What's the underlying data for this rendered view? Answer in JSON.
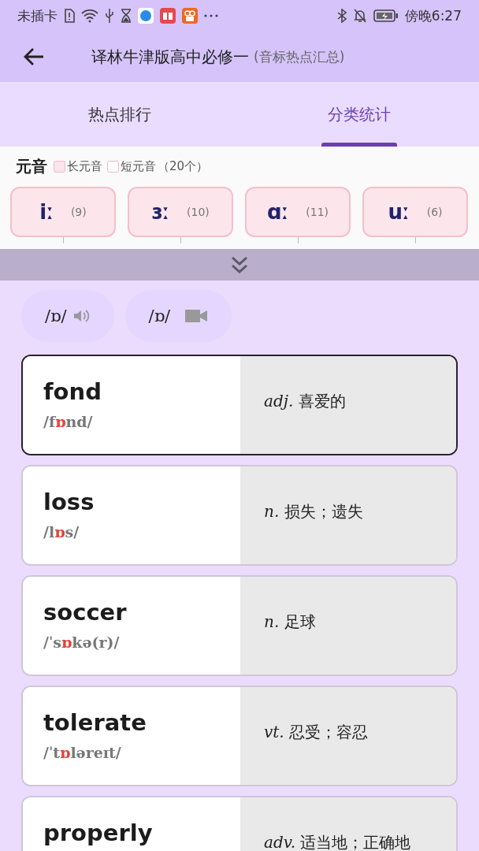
{
  "status_bar": {
    "carrier": "未插卡",
    "time": "傍晚6:27"
  },
  "header": {
    "title": "译林牛津版高中必修一",
    "subtitle": "(音标热点汇总)"
  },
  "tabs": [
    {
      "label": "热点排行",
      "selected": false
    },
    {
      "label": "分类统计",
      "selected": true
    }
  ],
  "vowels": {
    "title": "元音",
    "legend": [
      {
        "label": "长元音",
        "color": "#fce4ec"
      },
      {
        "label": "短元音",
        "color": "#ffffff"
      }
    ],
    "count": "（20个）",
    "chips": [
      {
        "symbol": "iː",
        "count": "(9)"
      },
      {
        "symbol": "ɜː",
        "count": "(10)"
      },
      {
        "symbol": "ɑː",
        "count": "(11)"
      },
      {
        "symbol": "uː",
        "count": "(6)"
      }
    ]
  },
  "sound_buttons": [
    {
      "kind": "audio",
      "label": "/ɒ/"
    },
    {
      "kind": "video",
      "label": "/ɒ/"
    }
  ],
  "words": [
    {
      "word": "fond",
      "phonetic": {
        "before": "/f",
        "stress": "ɒ",
        "after": "nd/"
      },
      "definition": "*adj.* 喜爱的",
      "selected": true
    },
    {
      "word": "loss",
      "phonetic": {
        "before": "/l",
        "stress": "ɒ",
        "after": "s/"
      },
      "definition": "*n.* 损失；遗失",
      "selected": false
    },
    {
      "word": "soccer",
      "phonetic": {
        "before": "/ˈs",
        "stress": "ɒ",
        "after": "kə(r)/"
      },
      "definition": "*n.* 足球",
      "selected": false
    },
    {
      "word": "tolerate",
      "phonetic": {
        "before": "/ˈt",
        "stress": "ɒ",
        "after": "ləreɪt/"
      },
      "definition": "*vt.* 忍受；容忍",
      "selected": false
    },
    {
      "word": "properly",
      "definition": "*adv.* 适当地；正确地",
      "selected": false
    }
  ]
}
